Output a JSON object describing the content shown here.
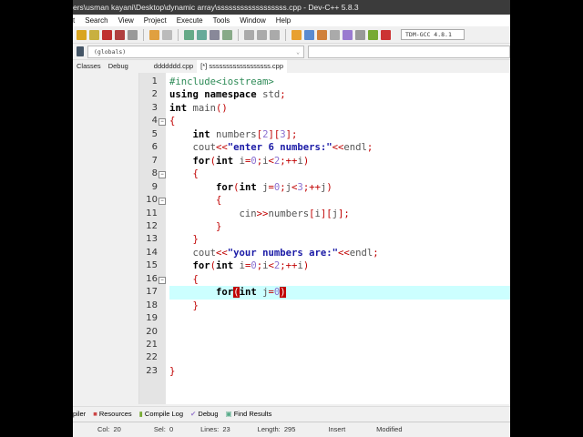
{
  "title": "ers\\usman kayani\\Desktop\\dynamic array\\ssssssssssssssssss.cpp - Dev-C++ 5.8.3",
  "menu": [
    "t",
    "Search",
    "View",
    "Project",
    "Execute",
    "Tools",
    "Window",
    "Help"
  ],
  "toolbar": {
    "compiler": "TDM-GCC 4.8.1"
  },
  "scope": {
    "globals": "(globals)"
  },
  "left_tabs": [
    "Classes",
    "Debug"
  ],
  "file_tabs": [
    "ddddddd.cpp",
    "[*] ssssssssssssssssss.cpp"
  ],
  "editor": {
    "current_line": 17,
    "lines": [
      [
        [
          "pre",
          "#include<iostream>"
        ]
      ],
      [
        [
          "kw",
          "using namespace "
        ],
        [
          "id",
          "std"
        ],
        [
          "sym",
          ";"
        ]
      ],
      [
        [
          "kw",
          "int "
        ],
        [
          "id",
          "main"
        ],
        [
          "sym",
          "()"
        ]
      ],
      [
        [
          "sym",
          "{"
        ]
      ],
      [
        [
          "id",
          "    "
        ],
        [
          "kw",
          "int "
        ],
        [
          "id",
          "numbers"
        ],
        [
          "sym",
          "["
        ],
        [
          "num",
          "2"
        ],
        [
          "sym",
          "]["
        ],
        [
          "num",
          "3"
        ],
        [
          "sym",
          "];"
        ]
      ],
      [
        [
          "id",
          "    cout"
        ],
        [
          "sym",
          "<<"
        ],
        [
          "str",
          "\"enter 6 numbers:\""
        ],
        [
          "sym",
          "<<"
        ],
        [
          "id",
          "endl"
        ],
        [
          "sym",
          ";"
        ]
      ],
      [
        [
          "id",
          "    "
        ],
        [
          "kw",
          "for"
        ],
        [
          "sym",
          "("
        ],
        [
          "kw",
          "int "
        ],
        [
          "id",
          "i"
        ],
        [
          "sym",
          "="
        ],
        [
          "num",
          "0"
        ],
        [
          "sym",
          ";"
        ],
        [
          "id",
          "i"
        ],
        [
          "sym",
          "<"
        ],
        [
          "num",
          "2"
        ],
        [
          "sym",
          ";++"
        ],
        [
          "id",
          "i"
        ],
        [
          "sym",
          ")"
        ]
      ],
      [
        [
          "id",
          "    "
        ],
        [
          "sym",
          "{"
        ]
      ],
      [
        [
          "id",
          "        "
        ],
        [
          "kw",
          "for"
        ],
        [
          "sym",
          "("
        ],
        [
          "kw",
          "int "
        ],
        [
          "id",
          "j"
        ],
        [
          "sym",
          "="
        ],
        [
          "num",
          "0"
        ],
        [
          "sym",
          ";"
        ],
        [
          "id",
          "j"
        ],
        [
          "sym",
          "<"
        ],
        [
          "num",
          "3"
        ],
        [
          "sym",
          ";++"
        ],
        [
          "id",
          "j"
        ],
        [
          "sym",
          ")"
        ]
      ],
      [
        [
          "id",
          "        "
        ],
        [
          "sym",
          "{"
        ]
      ],
      [
        [
          "id",
          "            cin"
        ],
        [
          "sym",
          ">>"
        ],
        [
          "id",
          "numbers"
        ],
        [
          "sym",
          "["
        ],
        [
          "id",
          "i"
        ],
        [
          "sym",
          "]["
        ],
        [
          "id",
          "j"
        ],
        [
          "sym",
          "];"
        ]
      ],
      [
        [
          "id",
          "        "
        ],
        [
          "sym",
          "}"
        ]
      ],
      [
        [
          "id",
          "    "
        ],
        [
          "sym",
          "}"
        ]
      ],
      [
        [
          "id",
          "    cout"
        ],
        [
          "sym",
          "<<"
        ],
        [
          "str",
          "\"your numbers are:\""
        ],
        [
          "sym",
          "<<"
        ],
        [
          "id",
          "endl"
        ],
        [
          "sym",
          ";"
        ]
      ],
      [
        [
          "id",
          "    "
        ],
        [
          "kw",
          "for"
        ],
        [
          "sym",
          "("
        ],
        [
          "kw",
          "int "
        ],
        [
          "id",
          "i"
        ],
        [
          "sym",
          "="
        ],
        [
          "num",
          "0"
        ],
        [
          "sym",
          ";"
        ],
        [
          "id",
          "i"
        ],
        [
          "sym",
          "<"
        ],
        [
          "num",
          "2"
        ],
        [
          "sym",
          ";++"
        ],
        [
          "id",
          "i"
        ],
        [
          "sym",
          ")"
        ]
      ],
      [
        [
          "id",
          "    "
        ],
        [
          "sym",
          "{"
        ]
      ],
      [
        [
          "id",
          "        "
        ],
        [
          "kw",
          "for"
        ],
        [
          "br",
          "("
        ],
        [
          "kw",
          "int "
        ],
        [
          "id",
          "j"
        ],
        [
          "sym",
          "="
        ],
        [
          "num",
          "0"
        ],
        [
          "br",
          ")"
        ]
      ],
      [
        [
          "id",
          "    "
        ],
        [
          "sym",
          "}"
        ]
      ],
      [],
      [],
      [],
      [],
      [
        [
          "sym",
          "}"
        ]
      ]
    ],
    "fold_lines": [
      4,
      8,
      10,
      16
    ]
  },
  "bottom_tabs": [
    "piler",
    "Resources",
    "Compile Log",
    "Debug",
    "Find Results"
  ],
  "status": {
    "col_label": "Col:",
    "col": "20",
    "sel_label": "Sel:",
    "sel": "0",
    "lines_label": "Lines:",
    "lines": "23",
    "length_label": "Length:",
    "length": "295",
    "mode": "Insert",
    "state": "Modified"
  }
}
